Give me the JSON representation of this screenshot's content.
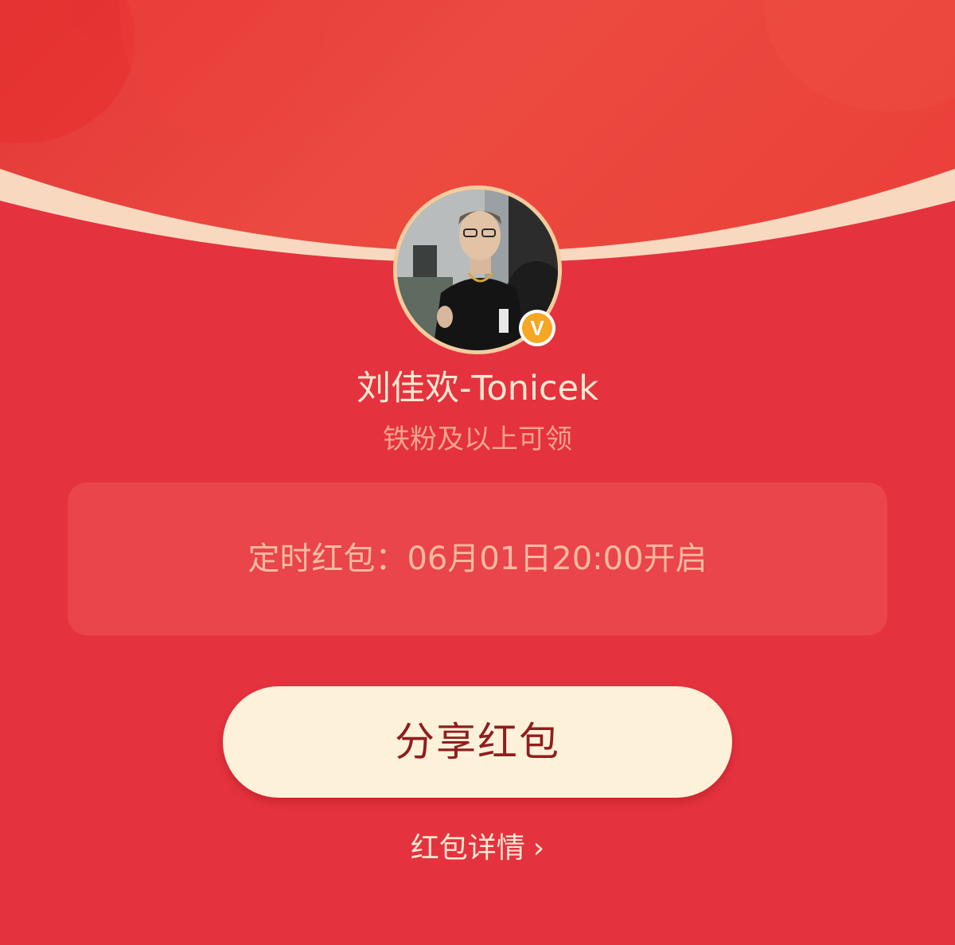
{
  "colors": {
    "background": "#e5323f",
    "arc": "#f8d9c0",
    "button": "#fdf1da",
    "button_text": "#8f1e1e",
    "badge": "#f5a623"
  },
  "sender": {
    "name": "刘佳欢-Tonicek",
    "verified_badge": "V",
    "avatar": "avatar-photo"
  },
  "eligibility": "铁粉及以上可领",
  "schedule": {
    "text": "定时红包：06月01日20:00开启"
  },
  "share_button": {
    "label": "分享红包"
  },
  "details_link": {
    "label": "红包详情",
    "icon": "chevron-right-icon",
    "glyph": "›"
  }
}
